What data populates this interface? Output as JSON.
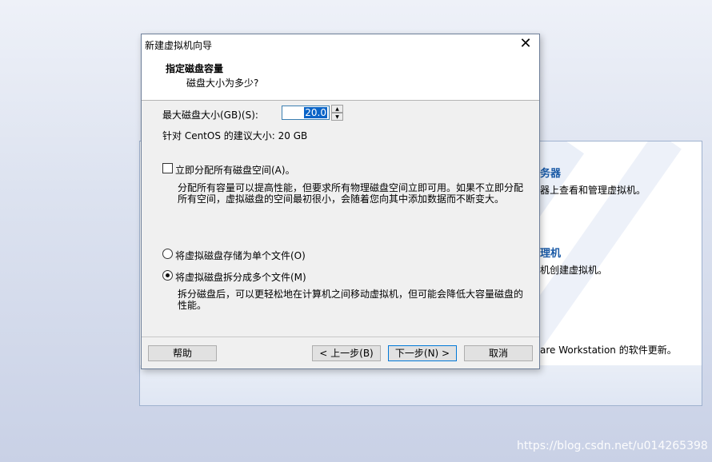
{
  "background": {
    "item1_title": "务器",
    "item1_desc": "器上查看和管理虚拟机。",
    "item2_title": "理机",
    "item2_desc": "机创建虚拟机。",
    "item3_desc": "are Workstation 的软件更新。"
  },
  "watermark": "https://blog.csdn.net/u014265398",
  "dialog": {
    "title": "新建虚拟机向导",
    "close_glyph": "✕",
    "section_title": "指定磁盘容量",
    "section_subtitle": "磁盘大小为多少?",
    "max_size_label": "最大磁盘大小(GB)(S):",
    "max_size_value": "20.0",
    "recommended": "针对 CentOS 的建议大小: 20 GB",
    "allocate_label": "立即分配所有磁盘空间(A)。",
    "allocate_checked": false,
    "allocate_desc_line1": "分配所有容量可以提高性能，但要求所有物理磁盘空间立即可用。如果不立即分配",
    "allocate_desc_line2": "所有空间，虚拟磁盘的空间最初很小，会随着您向其中添加数据而不断变大。",
    "radio_single": "将虚拟磁盘存储为单个文件(O)",
    "radio_multi": "将虚拟磁盘拆分成多个文件(M)",
    "selected_option": "multi",
    "multi_desc_line1": "拆分磁盘后，可以更轻松地在计算机之间移动虚拟机，但可能会降低大容量磁盘的",
    "multi_desc_line2": "性能。",
    "buttons": {
      "help": "帮助",
      "back": "< 上一步(B)",
      "next": "下一步(N) >",
      "cancel": "取消"
    }
  }
}
